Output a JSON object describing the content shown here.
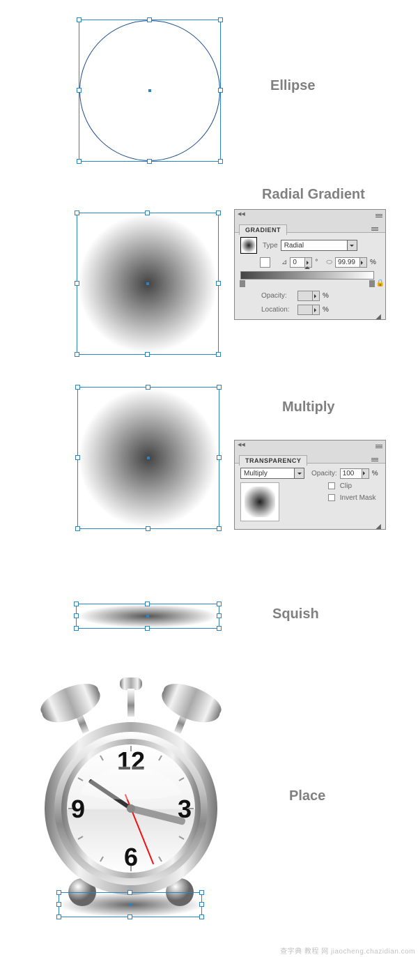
{
  "steps": {
    "ellipse": "Ellipse",
    "radial_gradient": "Radial Gradient",
    "multiply": "Multiply",
    "squish": "Squish",
    "place": "Place"
  },
  "gradient_panel": {
    "title": "GRADIENT",
    "type_label": "Type",
    "type_value": "Radial",
    "angle_value": "0",
    "angle_unit": "°",
    "scale_value": "99.99",
    "pct": "%",
    "opacity_label": "Opacity:",
    "location_label": "Location:"
  },
  "transparency_panel": {
    "title": "TRANSPARENCY",
    "mode_value": "Multiply",
    "opacity_label": "Opacity:",
    "opacity_value": "100",
    "pct": "%",
    "clip_label": "Clip",
    "invert_label": "Invert Mask"
  },
  "clock": {
    "n12": "12",
    "n3": "3",
    "n6": "6",
    "n9": "9"
  },
  "watermark": "查字典 教程 网  jiaocheng.chazidian.com"
}
